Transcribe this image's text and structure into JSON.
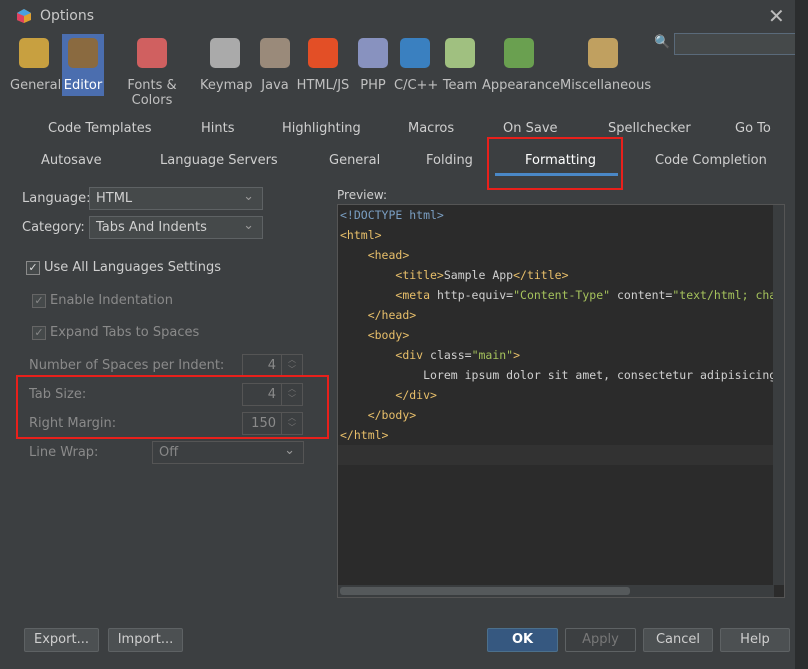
{
  "window": {
    "title": "Options",
    "close_icon": "close-icon"
  },
  "categories": [
    {
      "label": "General",
      "icon": "wrench-gear-icon",
      "color": "#c8a040"
    },
    {
      "label": "Editor",
      "icon": "editor-pencil-icon",
      "color": "#8a6a40",
      "selected": true
    },
    {
      "label": "Fonts & Colors",
      "icon": "fonts-colors-icon",
      "color": "#d06060"
    },
    {
      "label": "Keymap",
      "icon": "keyboard-icon",
      "color": "#aaaaaa"
    },
    {
      "label": "Java",
      "icon": "java-cup-icon",
      "color": "#9a8a7a"
    },
    {
      "label": "HTML/JS",
      "icon": "html5-icon",
      "color": "#e34f26"
    },
    {
      "label": "PHP",
      "icon": "php-icon",
      "color": "#8892bf"
    },
    {
      "label": "C/C++",
      "icon": "cpp-icon",
      "color": "#3a80c0"
    },
    {
      "label": "Team",
      "icon": "team-cubes-icon",
      "color": "#a0c080"
    },
    {
      "label": "Appearance",
      "icon": "appearance-icon",
      "color": "#6aa050"
    },
    {
      "label": "Miscellaneous",
      "icon": "misc-gear-icon",
      "color": "#c0a060"
    }
  ],
  "search": {
    "value": "",
    "icon": "search-icon"
  },
  "tabs_row1": [
    "Code Templates",
    "Hints",
    "Highlighting",
    "Macros",
    "On Save",
    "Spellchecker",
    "Go To"
  ],
  "tabs_row2": [
    "Autosave",
    "Language Servers",
    "General",
    "Folding",
    "Formatting",
    "Code Completion"
  ],
  "active_tab": "Formatting",
  "form": {
    "language_label": "Language:",
    "language_value": "HTML",
    "category_label": "Category:",
    "category_value": "Tabs And Indents",
    "use_all": "Use All Languages Settings",
    "enable_indent": "Enable Indentation",
    "expand_tabs": "Expand Tabs to Spaces",
    "spaces_label": "Number of Spaces per Indent:",
    "spaces_value": "4",
    "tab_size_label": "Tab Size:",
    "tab_size_value": "4",
    "right_margin_label": "Right Margin:",
    "right_margin_value": "150",
    "line_wrap_label": "Line Wrap:",
    "line_wrap_value": "Off"
  },
  "preview": {
    "label": "Preview:"
  },
  "buttons": {
    "export": "Export...",
    "import": "Import...",
    "ok": "OK",
    "apply": "Apply",
    "cancel": "Cancel",
    "help": "Help"
  },
  "highlight_color": "#e8201b"
}
